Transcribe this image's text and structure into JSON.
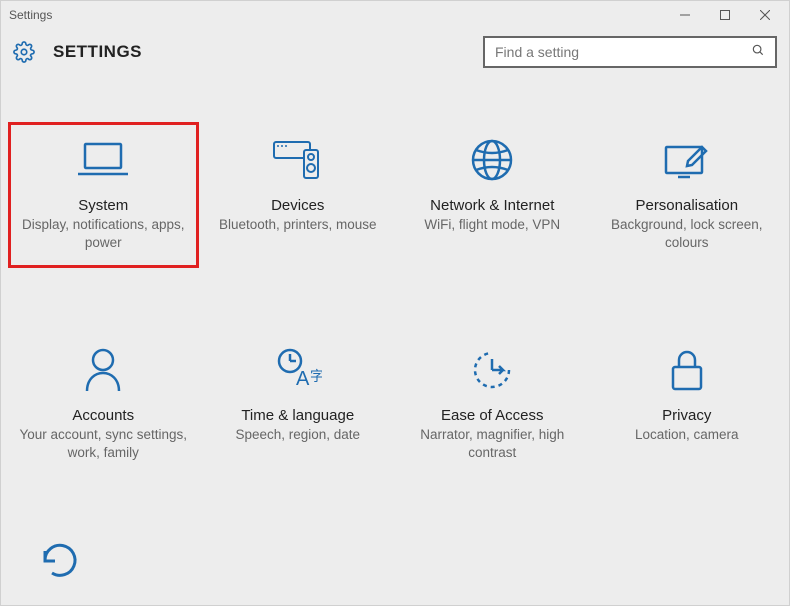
{
  "window": {
    "title": "Settings"
  },
  "header": {
    "title": "SETTINGS",
    "search_placeholder": "Find a setting"
  },
  "tiles": [
    {
      "title": "System",
      "desc": "Display, notifications, apps, power",
      "highlight": true
    },
    {
      "title": "Devices",
      "desc": "Bluetooth, printers, mouse",
      "highlight": false
    },
    {
      "title": "Network & Internet",
      "desc": "WiFi, flight mode, VPN",
      "highlight": false
    },
    {
      "title": "Personalisation",
      "desc": "Background, lock screen, colours",
      "highlight": false
    },
    {
      "title": "Accounts",
      "desc": "Your account, sync settings, work, family",
      "highlight": false
    },
    {
      "title": "Time & language",
      "desc": "Speech, region, date",
      "highlight": false
    },
    {
      "title": "Ease of Access",
      "desc": "Narrator, magnifier, high contrast",
      "highlight": false
    },
    {
      "title": "Privacy",
      "desc": "Location, camera",
      "highlight": false
    }
  ]
}
